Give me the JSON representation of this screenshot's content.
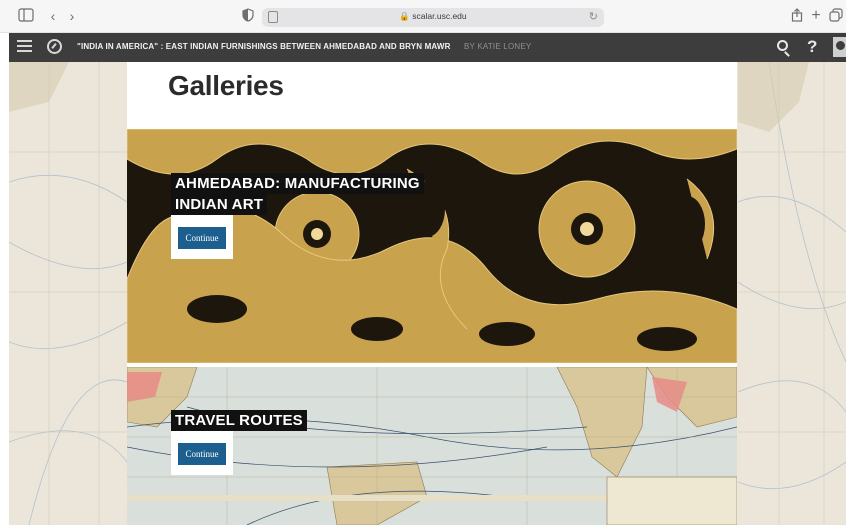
{
  "browser": {
    "url": "scalar.usc.edu"
  },
  "nav": {
    "title": "\"INDIA IN AMERICA\" : EAST INDIAN FURNISHINGS BETWEEN AHMEDABAD AND BRYN MAWR",
    "author": "BY KATIE LONEY"
  },
  "main": {
    "page_title": "Galleries",
    "galleries": [
      {
        "title_line1": "AHMEDABAD: MANUFACTURING",
        "title_line2": "INDIAN ART",
        "button_label": "Continue"
      },
      {
        "title_line1": "TRAVEL ROUTES",
        "button_label": "Continue"
      }
    ]
  },
  "colors": {
    "nav_bg": "#3d3d3d",
    "button_bg": "#1c5f8f",
    "label_bg": "#111111"
  }
}
